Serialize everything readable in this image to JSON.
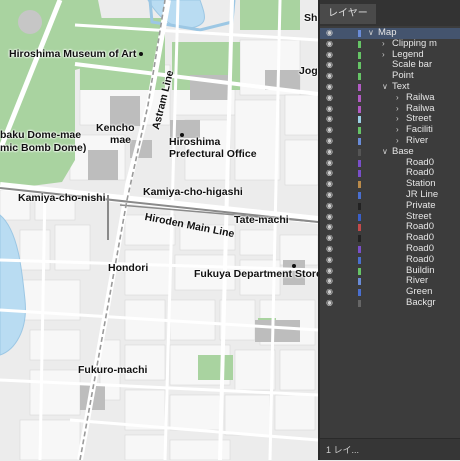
{
  "map": {
    "labels": {
      "museum": "Hiroshima Museum of Art",
      "shu": "Shu",
      "joga": "Joga",
      "astram": "Astram Line",
      "dome1": "baku Dome-mae",
      "dome2": "mic Bomb Dome)",
      "kencho1": "Kencho",
      "kencho2": "mae",
      "pref1": "Hiroshima",
      "pref2": "Prefectural Office",
      "kamiya_nishi": "Kamiya-cho-nishi",
      "kamiya_higashi": "Kamiya-cho-higashi",
      "hiroden": "Hiroden Main Line",
      "tate": "Tate-machi",
      "hondori": "Hondori",
      "fukuya": "Fukuya Department Store",
      "fukuro": "Fukuro-machi"
    },
    "colors": {
      "background": "#ececec",
      "block": "#f6f6f6",
      "road": "#ffffff",
      "green": "#a9d3a0",
      "water": "#b9dcf2",
      "building": "#bdbdbd",
      "rail": "#8a8a8a"
    }
  },
  "panel": {
    "tab_label": "レイヤー",
    "footer": "1 レイ...",
    "layers": [
      {
        "name": "Map",
        "level": 0,
        "expanded": true,
        "selected": true,
        "color": "#6a8cd8"
      },
      {
        "name": "Clipping m",
        "level": 1,
        "expanded": false,
        "color": "#66c466"
      },
      {
        "name": "Legend",
        "level": 1,
        "expanded": false,
        "color": "#66c466"
      },
      {
        "name": "Scale bar",
        "level": 1,
        "expanded": null,
        "color": "#66c466"
      },
      {
        "name": "Point",
        "level": 1,
        "expanded": null,
        "color": "#66c466"
      },
      {
        "name": "Text",
        "level": 1,
        "expanded": true,
        "color": "#b25bc4"
      },
      {
        "name": "Railwa",
        "level": 2,
        "expanded": false,
        "color": "#b25bc4"
      },
      {
        "name": "Railwa",
        "level": 2,
        "expanded": false,
        "color": "#b25bc4"
      },
      {
        "name": "Street",
        "level": 2,
        "expanded": false,
        "color": "#9dd0e6"
      },
      {
        "name": "Faciliti",
        "level": 2,
        "expanded": false,
        "color": "#66c466"
      },
      {
        "name": "River",
        "level": 2,
        "expanded": false,
        "color": "#6a8cd8"
      },
      {
        "name": "Base",
        "level": 1,
        "expanded": true,
        "color": "#555555"
      },
      {
        "name": "Road0",
        "level": 2,
        "expanded": null,
        "color": "#7a4fc9"
      },
      {
        "name": "Road0",
        "level": 2,
        "expanded": null,
        "color": "#7a4fc9"
      },
      {
        "name": "Station",
        "level": 2,
        "expanded": null,
        "color": "#b98a4a"
      },
      {
        "name": "JR Line",
        "level": 2,
        "expanded": null,
        "color": "#4a6fcf"
      },
      {
        "name": "Private",
        "level": 2,
        "expanded": null,
        "color": "#222222"
      },
      {
        "name": "Street",
        "level": 2,
        "expanded": null,
        "color": "#3a5fc8"
      },
      {
        "name": "Road0",
        "level": 2,
        "expanded": null,
        "color": "#c44a4a"
      },
      {
        "name": "Road0",
        "level": 2,
        "expanded": null,
        "color": "#222222"
      },
      {
        "name": "Road0",
        "level": 2,
        "expanded": null,
        "color": "#7a4fc9"
      },
      {
        "name": "Road0",
        "level": 2,
        "expanded": null,
        "color": "#4a6fcf"
      },
      {
        "name": "Buildin",
        "level": 2,
        "expanded": null,
        "color": "#66c466"
      },
      {
        "name": "River",
        "level": 2,
        "expanded": null,
        "color": "#6a8cd8"
      },
      {
        "name": "Green",
        "level": 2,
        "expanded": null,
        "color": "#4a6fcf"
      },
      {
        "name": "Backgr",
        "level": 2,
        "expanded": null,
        "color": "#666666"
      }
    ]
  }
}
